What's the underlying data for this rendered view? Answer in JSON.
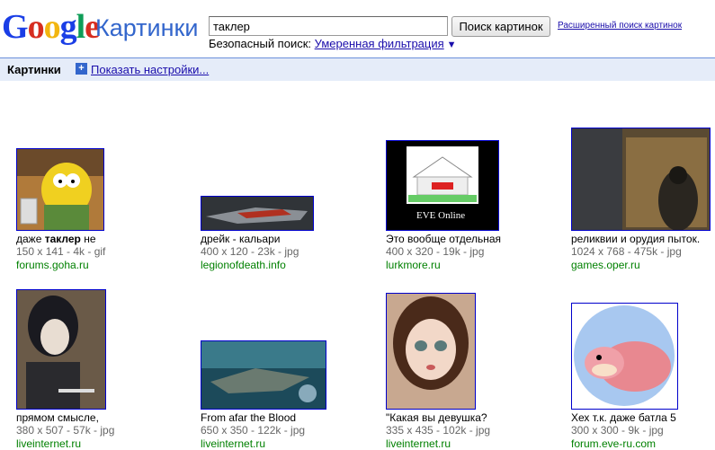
{
  "header": {
    "logo_letters": [
      {
        "ch": "G",
        "color": "#1a3ee6"
      },
      {
        "ch": "o",
        "color": "#d62d20"
      },
      {
        "ch": "o",
        "color": "#f2b50f"
      },
      {
        "ch": "g",
        "color": "#1a3ee6"
      },
      {
        "ch": "l",
        "color": "#0f9d58"
      },
      {
        "ch": "e",
        "color": "#d62d20"
      }
    ],
    "logo_sub": "Картинки",
    "search_value": "таклер",
    "search_button": "Поиск картинок",
    "advanced_link": "Расширенный поиск картинок",
    "safe_label": "Безопасный поиск:",
    "safe_value": "Умеренная фильтрация",
    "safe_arrow": "▼"
  },
  "toolbar": {
    "title": "Картинки",
    "plus": "+",
    "show_settings": "Показать настройки..."
  },
  "results": [
    {
      "title_pre": "даже ",
      "title_bold": "таклер",
      "title_post": " не",
      "meta": "150 x 141 - 4k - gif",
      "site": "forums.goha.ru"
    },
    {
      "title_pre": "дрейк - кальари",
      "title_bold": "",
      "title_post": "",
      "meta": "400 x 120 - 23k - jpg",
      "site": "legionofdeath.info"
    },
    {
      "title_pre": "Это вообще отдельная",
      "title_bold": "",
      "title_post": "",
      "meta": "400 x 320 - 19k - jpg",
      "site": "lurkmore.ru",
      "thumb_text": "EVE Online"
    },
    {
      "title_pre": "реликвии и орудия пыток.",
      "title_bold": "",
      "title_post": "",
      "meta": "1024 x 768 - 475k - jpg",
      "site": "games.oper.ru"
    },
    {
      "title_pre": "прямом смысле,",
      "title_bold": "",
      "title_post": "",
      "meta": "380 x 507 - 57k - jpg",
      "site": "liveinternet.ru"
    },
    {
      "title_pre": "From afar the Blood",
      "title_bold": "",
      "title_post": "",
      "meta": "650 x 350 - 122k - jpg",
      "site": "liveinternet.ru"
    },
    {
      "title_pre": "\"Какая вы девушка?",
      "title_bold": "",
      "title_post": "",
      "meta": "335 x 435 - 102k - jpg",
      "site": "liveinternet.ru"
    },
    {
      "title_pre": "Хех т.к. даже батла 5",
      "title_bold": "",
      "title_post": "",
      "meta": "300 x 300 - 9k - jpg",
      "site": "forum.eve-ru.com"
    }
  ]
}
